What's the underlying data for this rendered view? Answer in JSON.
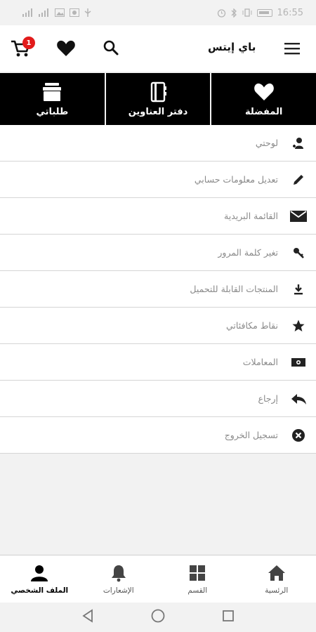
{
  "status_bar": {
    "time": "16:55",
    "accent": "#b5b5b5"
  },
  "header": {
    "brand": "باي إيتس",
    "cart_count": "1",
    "badge_color": "#e21b1b"
  },
  "quick_actions": [
    {
      "label": "طلباتي",
      "icon": "box-icon"
    },
    {
      "label": "دفتر العناوين",
      "icon": "address-book-icon"
    },
    {
      "label": "المفضلة",
      "icon": "heart-icon"
    }
  ],
  "menu": [
    {
      "label": "لوحتي",
      "icon": "user-icon"
    },
    {
      "label": "تعديل معلومات حسابي",
      "icon": "pencil-icon"
    },
    {
      "label": "القائمة البريدية",
      "icon": "envelope-icon"
    },
    {
      "label": "تغير كلمة المرور",
      "icon": "key-icon"
    },
    {
      "label": "المنتجات القابلة للتحميل",
      "icon": "download-icon"
    },
    {
      "label": "نقاط مكافئاتي",
      "icon": "star-icon"
    },
    {
      "label": "المعاملات",
      "icon": "money-icon"
    },
    {
      "label": "إرجاع",
      "icon": "reply-icon"
    },
    {
      "label": "تسجيل الخروج",
      "icon": "close-circle-icon"
    }
  ],
  "bottom_nav": [
    {
      "label": "الملف الشخصي",
      "icon": "profile-icon",
      "active": true
    },
    {
      "label": "الإشعارات",
      "icon": "bell-icon",
      "active": false
    },
    {
      "label": "القسم",
      "icon": "grid-icon",
      "active": false
    },
    {
      "label": "الرئسية",
      "icon": "home-icon",
      "active": false
    }
  ]
}
